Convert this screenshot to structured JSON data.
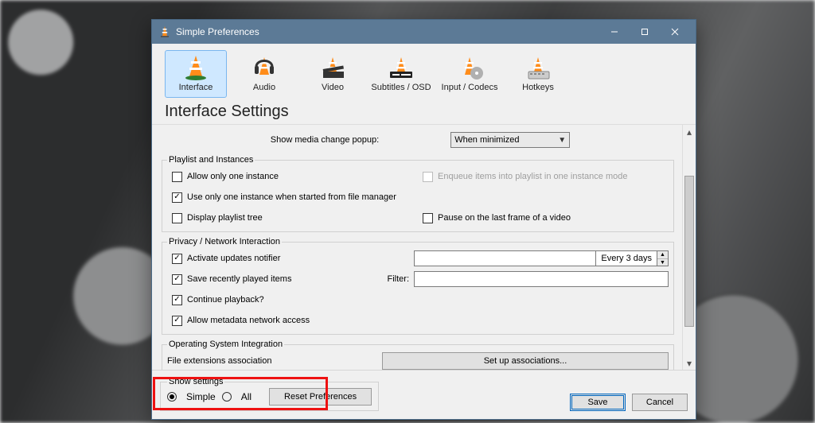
{
  "window": {
    "title": "Simple Preferences"
  },
  "categories": [
    {
      "id": "interface",
      "label": "Interface"
    },
    {
      "id": "audio",
      "label": "Audio"
    },
    {
      "id": "video",
      "label": "Video"
    },
    {
      "id": "subs",
      "label": "Subtitles / OSD"
    },
    {
      "id": "codecs",
      "label": "Input / Codecs"
    },
    {
      "id": "hotkeys",
      "label": "Hotkeys"
    }
  ],
  "heading": "Interface Settings",
  "media_popup": {
    "label": "Show media change popup:",
    "value": "When minimized"
  },
  "playlist_group": "Playlist and Instances",
  "playlist": {
    "one_instance": "Allow only one instance",
    "one_from_fm": "Use only one instance when started from file manager",
    "display_tree": "Display playlist tree",
    "enqueue": "Enqueue items into playlist in one instance mode",
    "pause_last": "Pause on the last frame of a video"
  },
  "privacy_group": "Privacy / Network Interaction",
  "privacy": {
    "updates": "Activate updates notifier",
    "updates_val": "Every 3 days",
    "recent": "Save recently played items",
    "filter": "Filter:",
    "continue": "Continue playback?",
    "metadata": "Allow metadata network access"
  },
  "os_group": "Operating System Integration",
  "os": {
    "assoc_label": "File extensions association",
    "assoc_btn": "Set up associations..."
  },
  "show_settings": {
    "group": "Show settings",
    "simple": "Simple",
    "all": "All",
    "reset": "Reset Preferences"
  },
  "buttons": {
    "save": "Save",
    "cancel": "Cancel"
  }
}
